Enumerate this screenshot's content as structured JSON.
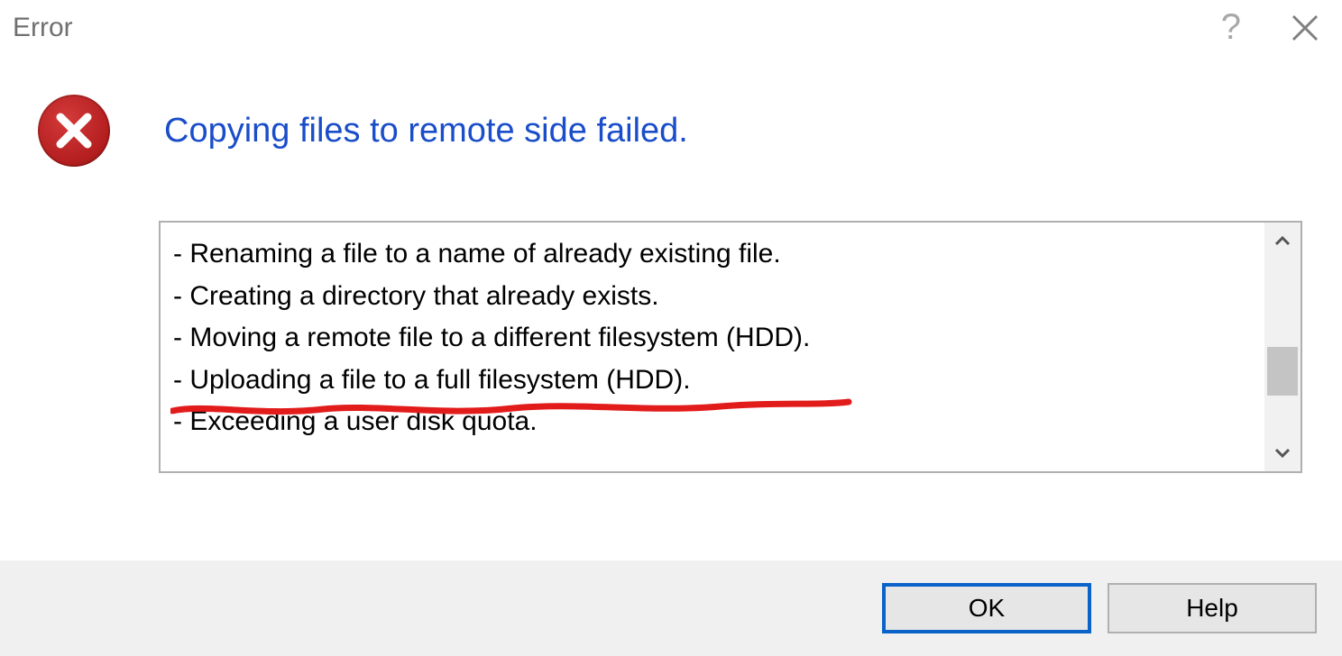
{
  "window": {
    "title": "Error",
    "help_icon": "?",
    "close_icon": "×"
  },
  "error": {
    "icon": "error-x",
    "headline": "Copying files to remote side failed."
  },
  "details": {
    "lines": [
      "- Renaming a file to a name of already existing file.",
      "- Creating a directory that already exists.",
      "- Moving a remote file to a different filesystem (HDD).",
      "- Uploading a file to a full filesystem (HDD).",
      "- Exceeding a user disk quota."
    ]
  },
  "annotation": {
    "type": "hand-underline",
    "target_line_index": 3,
    "color": "#e21b1b"
  },
  "buttons": {
    "ok": "OK",
    "help": "Help"
  }
}
